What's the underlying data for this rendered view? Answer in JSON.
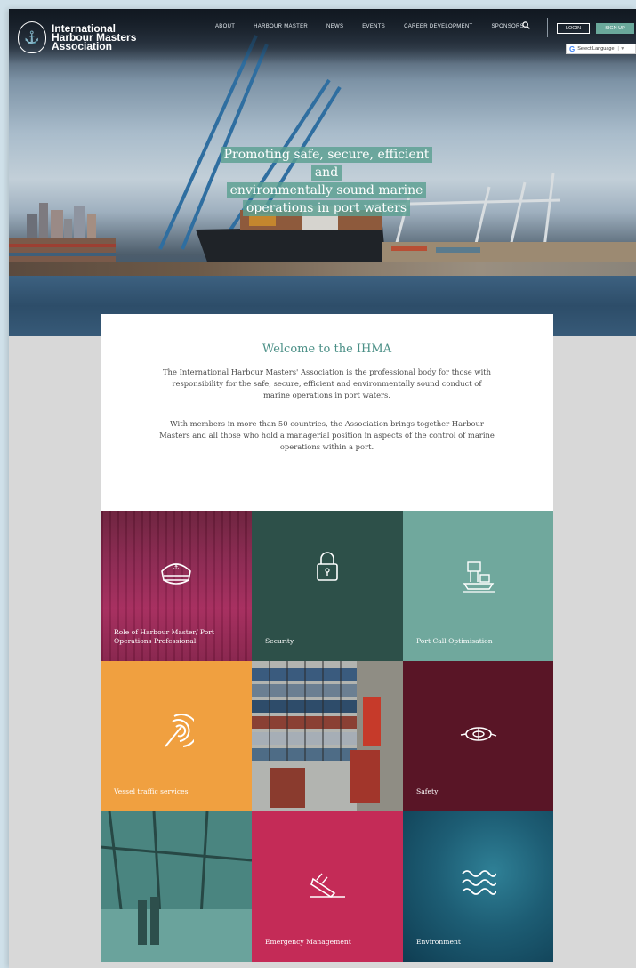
{
  "logo": {
    "line1": "International",
    "line2": "Harbour Masters",
    "line3": "Association"
  },
  "nav": {
    "items": [
      "ABOUT",
      "HARBOUR MASTER",
      "NEWS",
      "EVENTS",
      "CAREER DEVELOPMENT",
      "SPONSORS"
    ],
    "login_label": "LOGIN",
    "signup_label": "SIGN UP",
    "language_label": "Select Language"
  },
  "hero": {
    "tagline_lines": [
      "Promoting safe, secure, efficient and",
      "environmentally sound marine",
      "operations in port waters"
    ]
  },
  "welcome": {
    "title": "Welcome to the IHMA",
    "paragraph1": "The International Harbour Masters' Association is the professional body for those with responsibility for the safe, secure, efficient and environmentally sound conduct of marine operations in port waters.",
    "paragraph2": "With members in more than 50 countries, the Association brings together Harbour Masters and all those who hold a managerial position in aspects of the control of marine operations within a port."
  },
  "tiles": [
    {
      "label": "Role of Harbour Master/ Port Operations Professional",
      "icon": "captain-hat-icon"
    },
    {
      "label": "Security",
      "icon": "padlock-icon"
    },
    {
      "label": "Port Call Optimisation",
      "icon": "port-crane-icon"
    },
    {
      "label": "Vessel traffic services",
      "icon": "radar-signal-icon"
    },
    {
      "label": "",
      "icon": "container-ship-photo"
    },
    {
      "label": "Safety",
      "icon": "lifebuoy-icon"
    },
    {
      "label": "",
      "icon": "port-workers-photo"
    },
    {
      "label": "Emergency Management",
      "icon": "sinking-ship-icon"
    },
    {
      "label": "Environment",
      "icon": "waves-icon"
    }
  ],
  "colors": {
    "accent_teal": "#6aa89b",
    "title_teal": "#4a8f86",
    "tile_role": "#8b2650",
    "tile_security": "#2d5049",
    "tile_portcall": "#70a89d",
    "tile_vts": "#f0a040",
    "tile_safety": "#591526",
    "tile_emergency": "#c42b57",
    "tile_environment": "#1d5d74"
  }
}
